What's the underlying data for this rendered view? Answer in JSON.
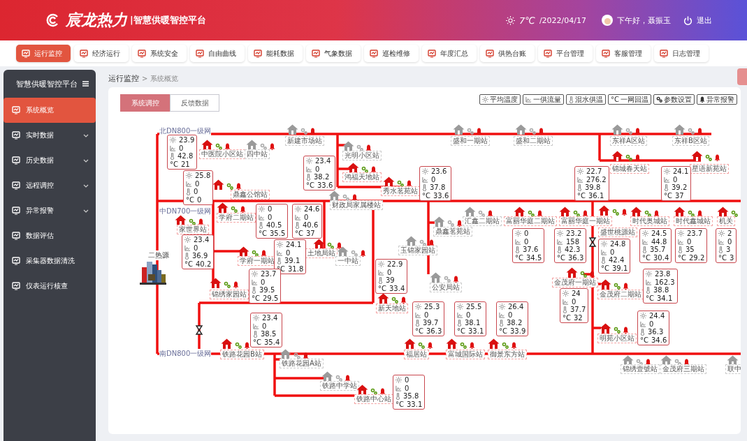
{
  "header": {
    "brand": "宸龙热力",
    "subtitle": "|智慧供暖智控平台",
    "temperature": "7℃",
    "date": "/2022/04/17",
    "greeting": "下午好，聂振玉",
    "logout": "退出"
  },
  "nav": [
    {
      "label": "运行监控",
      "selected": true
    },
    {
      "label": "经济运行",
      "selected": false
    },
    {
      "label": "系统安全",
      "selected": false
    },
    {
      "label": "自由曲线",
      "selected": false
    },
    {
      "label": "能耗数据",
      "selected": false
    },
    {
      "label": "气象数据",
      "selected": false
    },
    {
      "label": "巡检维修",
      "selected": false
    },
    {
      "label": "年度汇总",
      "selected": false
    },
    {
      "label": "供热台账",
      "selected": false
    },
    {
      "label": "平台管理",
      "selected": false
    },
    {
      "label": "客服管理",
      "selected": false
    },
    {
      "label": "日志管理",
      "selected": false
    }
  ],
  "sidebar": {
    "title": "智慧供暖智控平台",
    "items": [
      {
        "label": "系统概览",
        "selected": true,
        "expandable": false
      },
      {
        "label": "实时数据",
        "selected": false,
        "expandable": true
      },
      {
        "label": "历史数据",
        "selected": false,
        "expandable": true
      },
      {
        "label": "远程调控",
        "selected": false,
        "expandable": true
      },
      {
        "label": "异常报警",
        "selected": false,
        "expandable": true
      },
      {
        "label": "数据评估",
        "selected": false,
        "expandable": false
      },
      {
        "label": "采集器数据清洗",
        "selected": false,
        "expandable": false
      },
      {
        "label": "仪表运行核查",
        "selected": false,
        "expandable": false
      }
    ]
  },
  "breadcrumb": {
    "parent": "运行监控",
    "separator": ">",
    "current": "系统概览"
  },
  "tabs": [
    {
      "label": "系统调控",
      "selected": true
    },
    {
      "label": "反馈数据",
      "selected": false
    }
  ],
  "legend": [
    {
      "kind": "sun",
      "label": "平均温度"
    },
    {
      "kind": "flow",
      "label": "一供流量"
    },
    {
      "kind": "thermo",
      "label": "混水供温"
    },
    {
      "kind": "celsius",
      "symbol": "°C",
      "label": "一网回温"
    },
    {
      "kind": "gear",
      "label": "参数设置"
    },
    {
      "kind": "bell",
      "label": "异常报警"
    }
  ],
  "networks": [
    "北DN800一级网",
    "中DN700一级网",
    "南DN800一级网"
  ],
  "heat_source": "二热源",
  "stations": [
    {
      "name": "新建市场站",
      "online": false
    },
    {
      "name": "中医院小区站",
      "online": true
    },
    {
      "name": "四中站",
      "online": false
    },
    {
      "name": "光明小区站",
      "online": false
    },
    {
      "name": "鸿福天地站",
      "online": true
    },
    {
      "name": "秀水茗苑站",
      "online": true
    },
    {
      "name": "鼎鑫公馆站",
      "online": true
    },
    {
      "name": "财政局家属楼站",
      "online": false
    },
    {
      "name": "盛和一期站",
      "online": false
    },
    {
      "name": "盛和二期站",
      "online": false
    },
    {
      "name": "东祥A区站",
      "online": false
    },
    {
      "name": "东祥B区站",
      "online": false
    },
    {
      "name": "锦城春天站",
      "online": true
    },
    {
      "name": "星语新苑站",
      "online": true
    },
    {
      "name": "学府二期站",
      "online": true
    },
    {
      "name": "家世界站",
      "online": true
    },
    {
      "name": "学府一期站",
      "online": true
    },
    {
      "name": "土地局站",
      "online": true
    },
    {
      "name": "一中站",
      "online": false
    },
    {
      "name": "玉锦家园站",
      "online": false
    },
    {
      "name": "鼎鑫茗苑站",
      "online": false
    },
    {
      "name": "汇鑫二期站",
      "online": false
    },
    {
      "name": "富丽华庭二期站",
      "online": true
    },
    {
      "name": "富丽华庭一期站",
      "online": true
    },
    {
      "name": "盛世桃源站",
      "online": true
    },
    {
      "name": "时代奥城站",
      "online": true
    },
    {
      "name": "时代鑫城站",
      "online": true
    },
    {
      "name": "机关",
      "online": true
    },
    {
      "name": "公安局站",
      "online": false
    },
    {
      "name": "锦绣家园站",
      "online": true
    },
    {
      "name": "新天地站",
      "online": true
    },
    {
      "name": "金茂府一期站",
      "online": true
    },
    {
      "name": "金茂府二期站",
      "online": true
    },
    {
      "name": "明苑小区站",
      "online": true
    },
    {
      "name": "铁路花园B站",
      "online": true
    },
    {
      "name": "福居站",
      "online": true
    },
    {
      "name": "富城国际站",
      "online": true
    },
    {
      "name": "御景东方站",
      "online": true
    },
    {
      "name": "铁路花园A站",
      "online": false
    },
    {
      "name": "铁路中学站",
      "online": false
    },
    {
      "name": "铁路中心站",
      "online": true
    },
    {
      "name": "锦绣壹號站",
      "online": false
    },
    {
      "name": "金茂府三期站",
      "online": false
    },
    {
      "name": "联中",
      "online": false
    }
  ],
  "readings": [
    {
      "avg": "23.9",
      "flow": "0",
      "mix": "42.8",
      "unit": "°C",
      "ret": "21"
    },
    {
      "avg": "25.8",
      "flow": "0",
      "mix": "0",
      "unit": "°C",
      "ret": "0"
    },
    {
      "avg": "23.4",
      "flow": "0",
      "mix": "38.2",
      "unit": "°C",
      "ret": "33.6"
    },
    {
      "avg": "23.6",
      "flow": "0",
      "mix": "37.8",
      "unit": "°C",
      "ret": "33.6"
    },
    {
      "avg": "0",
      "flow": "0",
      "mix": "40.5",
      "unit": "°C",
      "ret": "35.5"
    },
    {
      "avg": "24.6",
      "flow": "0",
      "mix": "40.6",
      "unit": "°C",
      "ret": "37"
    },
    {
      "avg": "23.4",
      "flow": "0",
      "mix": "36.9",
      "unit": "°C",
      "ret": "40.2"
    },
    {
      "avg": "24.1",
      "flow": "0",
      "mix": "39.1",
      "unit": "°C",
      "ret": "31.8"
    },
    {
      "avg": "23.7",
      "flow": "0",
      "mix": "39.5",
      "unit": "°C",
      "ret": "29.5"
    },
    {
      "avg": "22.9",
      "flow": "0",
      "mix": "39",
      "unit": "°C",
      "ret": "33.4"
    },
    {
      "avg": "22.7",
      "flow": "276.2",
      "mix": "39.8",
      "unit": "°C",
      "ret": "36.1"
    },
    {
      "avg": "24.1",
      "flow": "0",
      "mix": "39.2",
      "unit": "°C",
      "ret": "37"
    },
    {
      "avg": "0",
      "flow": "0",
      "mix": "37.6",
      "unit": "°C",
      "ret": "34.5"
    },
    {
      "avg": "23.2",
      "flow": "158",
      "mix": "42.3",
      "unit": "°C",
      "ret": "36.3"
    },
    {
      "avg": "24.8",
      "flow": "0",
      "mix": "42.4",
      "unit": "°C",
      "ret": "39.1"
    },
    {
      "avg": "24.5",
      "flow": "44.8",
      "mix": "35.7",
      "unit": "°C",
      "ret": "30.4"
    },
    {
      "avg": "23.7",
      "flow": "0",
      "mix": "35",
      "unit": "°C",
      "ret": "29.2"
    },
    {
      "avg": "2",
      "flow": "0",
      "mix": "3",
      "unit": "°C",
      "ret": "3"
    },
    {
      "avg": "23.8",
      "flow": "162.3",
      "mix": "38.8",
      "unit": "°C",
      "ret": "34.1"
    },
    {
      "avg": "24",
      "flow": "0",
      "mix": "37.7",
      "unit": "°C",
      "ret": "32"
    },
    {
      "avg": "25.3",
      "flow": "0",
      "mix": "39.7",
      "unit": "°C",
      "ret": "36.3"
    },
    {
      "avg": "25.5",
      "flow": "0",
      "mix": "38.1",
      "unit": "°C",
      "ret": "33.1"
    },
    {
      "avg": "26.4",
      "flow": "0",
      "mix": "38.2",
      "unit": "°C",
      "ret": "33.9"
    },
    {
      "avg": "23.4",
      "flow": "0",
      "mix": "38.5",
      "unit": "°C",
      "ret": "35.4"
    },
    {
      "avg": "24.4",
      "flow": "0",
      "mix": "36.3",
      "unit": "°C",
      "ret": "34.6"
    },
    {
      "avg": "0",
      "flow": "0",
      "mix": "35.8",
      "unit": "°C",
      "ret": "33.1"
    }
  ]
}
